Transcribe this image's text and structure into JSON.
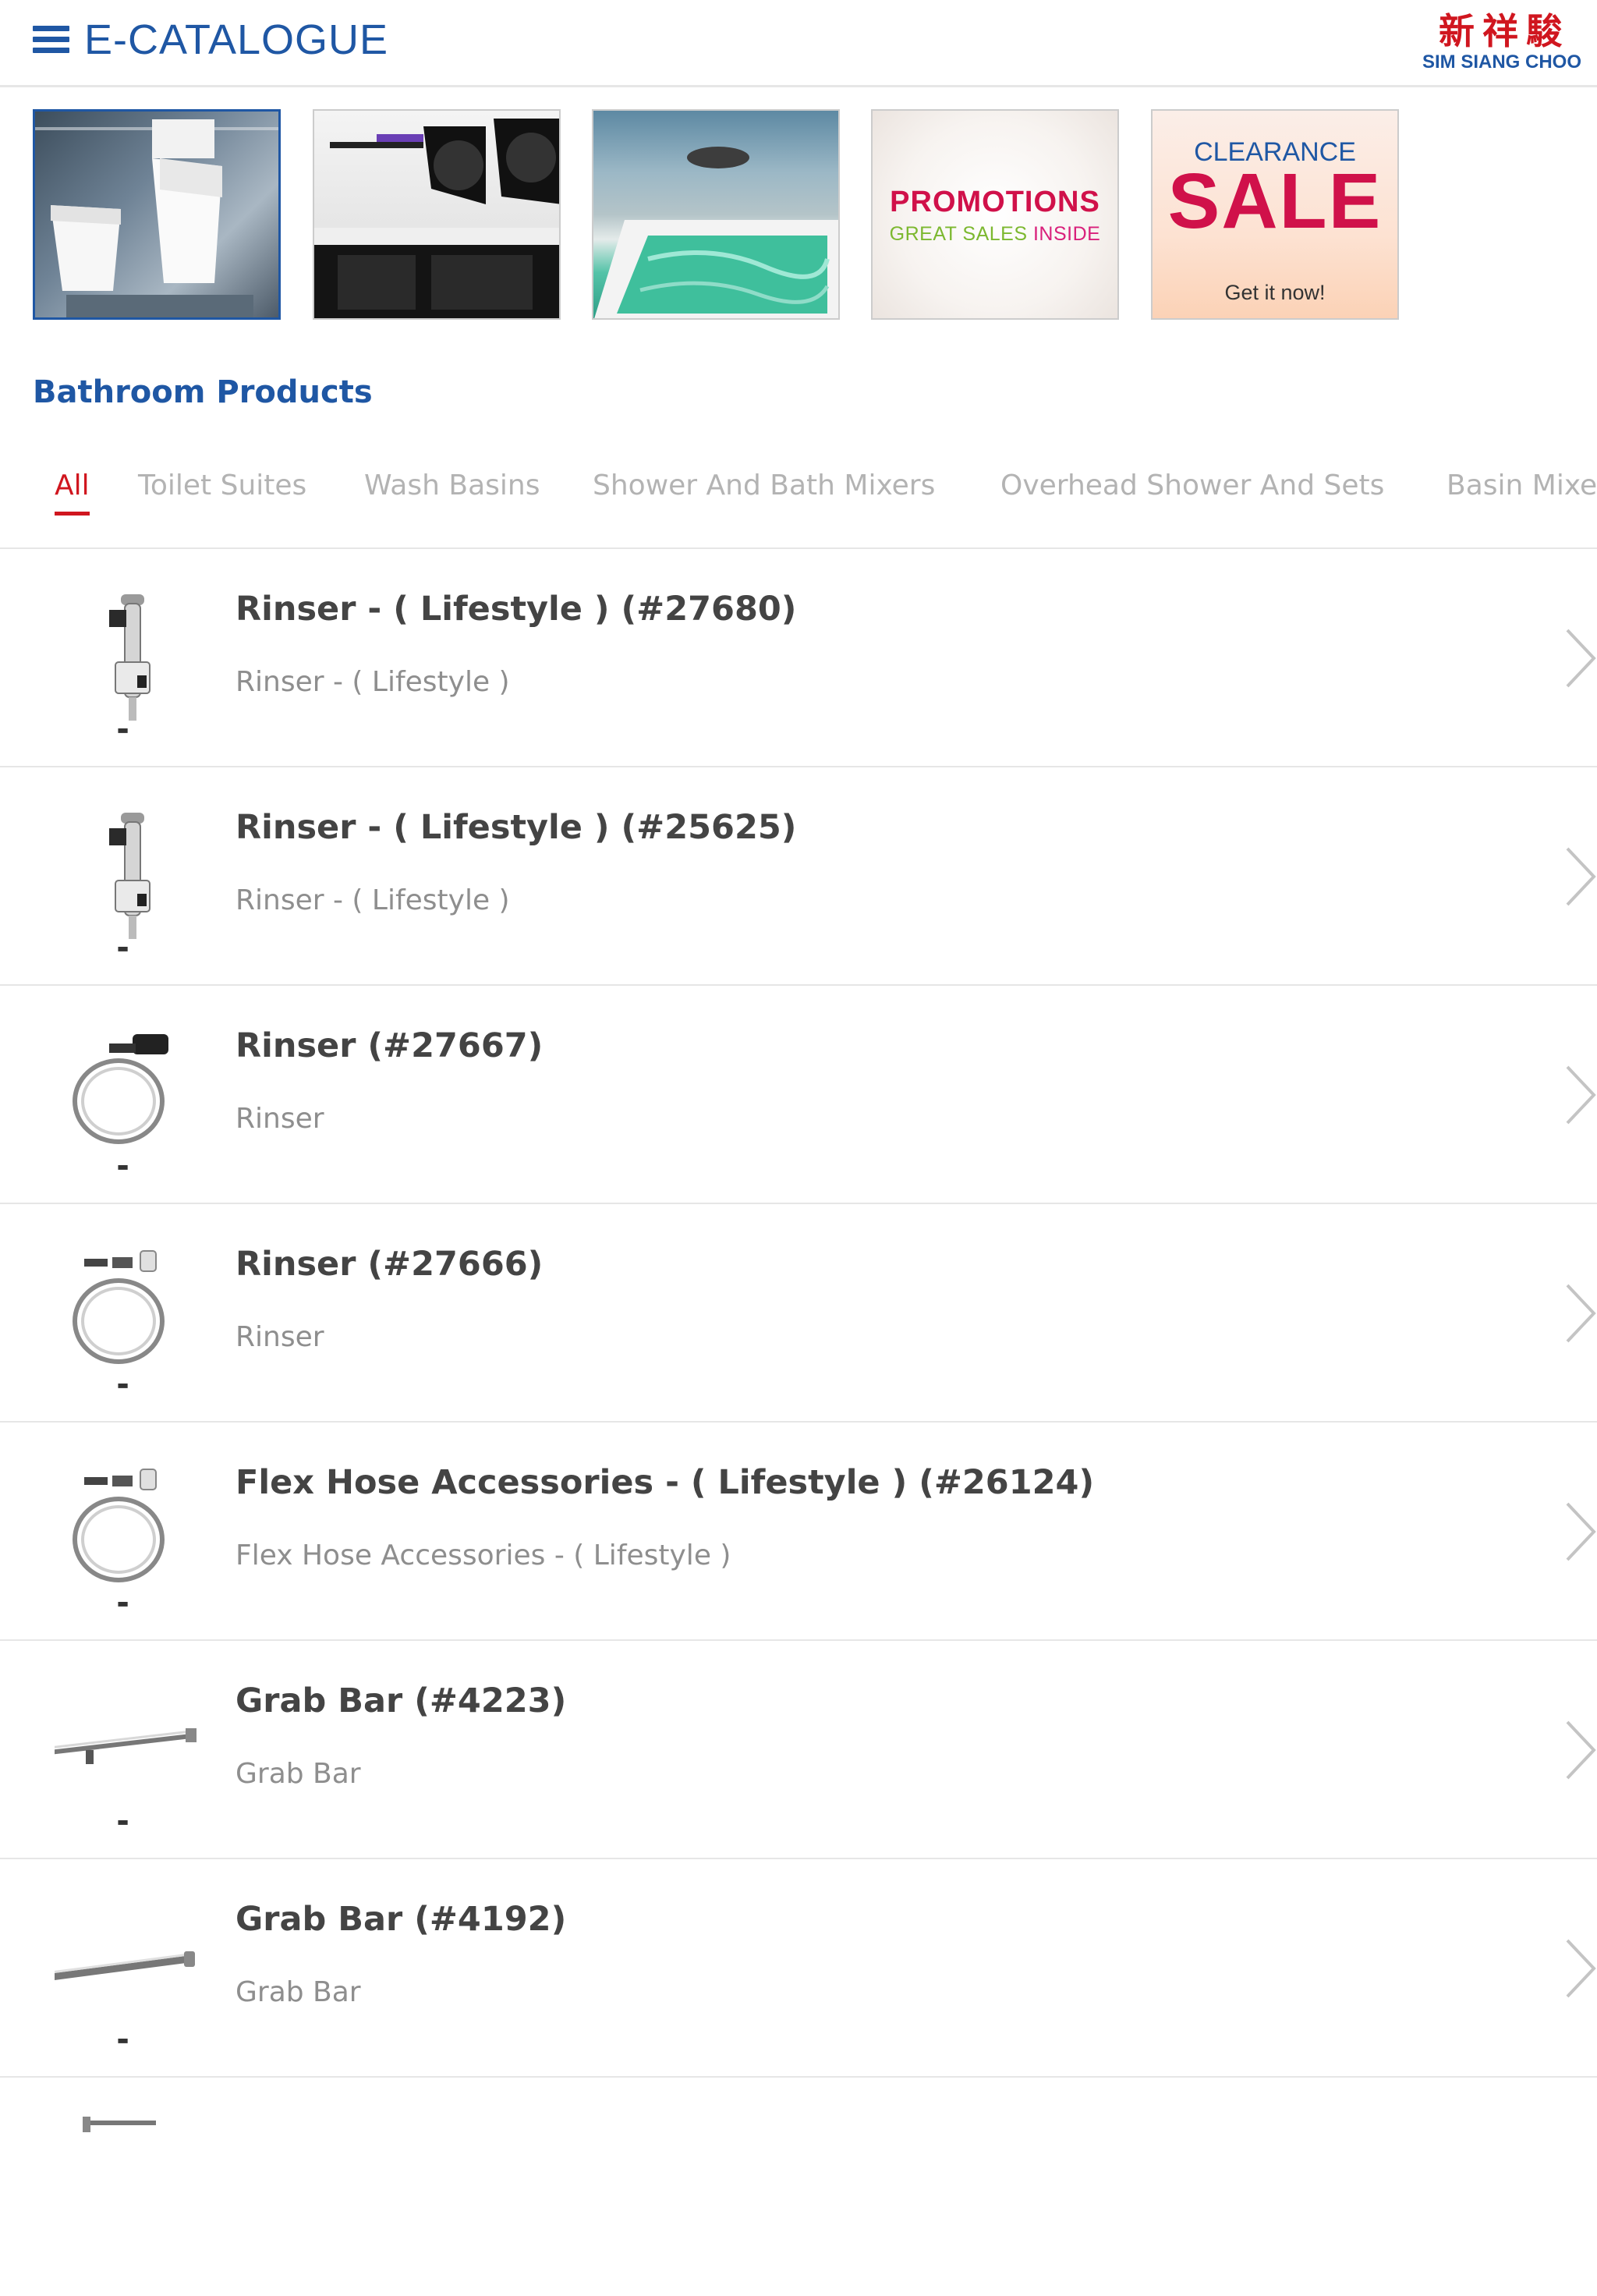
{
  "header": {
    "title": "E-CATALOGUE",
    "logo_cn": "新祥駿",
    "logo_en": "SIM SIANG CHOO"
  },
  "banners": {
    "promotions": {
      "title": "PROMOTIONS",
      "sub_part1": "GREAT SALES",
      "sub_part2": "INSIDE"
    },
    "clearance": {
      "top": "CLEARANCE",
      "big": "SALE",
      "bottom": "Get it now!"
    }
  },
  "section_title": "Bathroom Products",
  "tabs": [
    {
      "label": "All",
      "active": true
    },
    {
      "label": "Toilet Suites"
    },
    {
      "label": "Wash Basins"
    },
    {
      "label": "Shower And Bath Mixers"
    },
    {
      "label": "Overhead Shower And Sets"
    },
    {
      "label": "Basin Mixers"
    }
  ],
  "products": [
    {
      "title": "Rinser - ( Lifestyle ) (#27680)",
      "subtitle": "Rinser - ( Lifestyle )",
      "icon": "rinser-icon"
    },
    {
      "title": "Rinser - ( Lifestyle ) (#25625)",
      "subtitle": "Rinser - ( Lifestyle )",
      "icon": "rinser-icon"
    },
    {
      "title": "Rinser (#27667)",
      "subtitle": "Rinser",
      "icon": "hose-icon"
    },
    {
      "title": "Rinser (#27666)",
      "subtitle": "Rinser",
      "icon": "hose-icon"
    },
    {
      "title": "Flex Hose Accessories - ( Lifestyle ) (#26124)",
      "subtitle": "Flex Hose Accessories - ( Lifestyle )",
      "icon": "hose-icon"
    },
    {
      "title": "Grab Bar (#4223)",
      "subtitle": "Grab Bar",
      "icon": "grab-bar-icon"
    },
    {
      "title": "Grab Bar (#4192)",
      "subtitle": "Grab Bar",
      "icon": "grab-bar-icon"
    }
  ],
  "colors": {
    "brand_blue": "#1f57a4",
    "accent_red": "#d0161f",
    "tab_inactive": "#b3b3b3"
  }
}
